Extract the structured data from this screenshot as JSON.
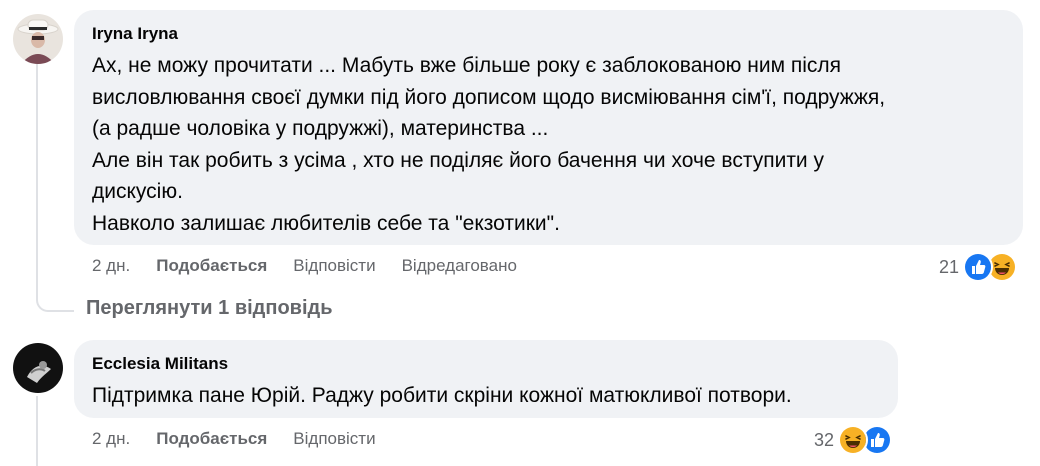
{
  "comments": [
    {
      "author": "Iryna Iryna",
      "lines": [
        "Ах, не можу прочитати ... Мабуть вже більше року є заблокованою ним після",
        "висловлювання своєї думки під його дописом щодо висміювання сім'ї, подружжя,",
        "(а радше чоловіка у подружжі), материнства ...",
        "Але він так робить з усіма , хто не поділяє його бачення чи хоче вступити у",
        "дискусію.",
        "Навколо залишає любителів себе та \"екзотики\"."
      ],
      "time": "2 дн.",
      "like_label": "Подобається",
      "reply_label": "Відповісти",
      "edited_label": "Відредаговано",
      "reaction_count": "21",
      "reactions": [
        "like-icon",
        "haha-icon"
      ]
    },
    {
      "author": "Ecclesia Militans",
      "lines": [
        "Підтримка пане Юрій. Раджу робити скріни кожної матюкливої потвори."
      ],
      "time": "2 дн.",
      "like_label": "Подобається",
      "reply_label": "Відповісти",
      "reaction_count": "32",
      "reactions": [
        "haha-icon",
        "like-icon"
      ]
    }
  ],
  "view_replies_label": "Переглянути 1 відповідь",
  "colors": {
    "bubble": "#f0f2f5",
    "meta_text": "#65676b",
    "like_blue": "#1877f2",
    "haha_yellow": "#f7b125"
  }
}
